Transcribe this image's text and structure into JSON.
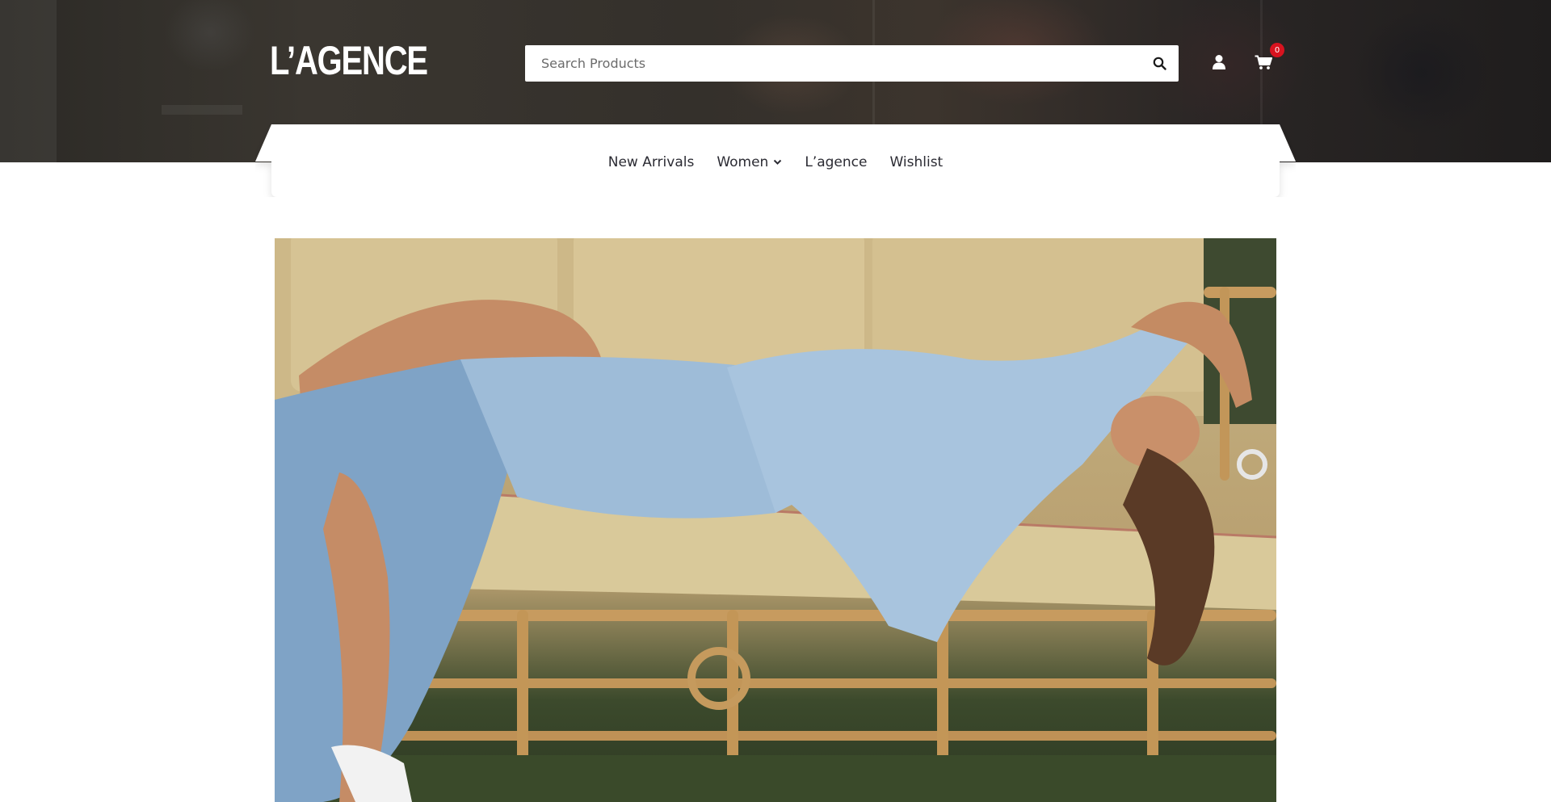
{
  "header": {
    "logo_text": "L’AGENCE",
    "search": {
      "placeholder": "Search Products",
      "value": ""
    },
    "icons": {
      "search": "search-icon",
      "account": "user-icon",
      "cart": "cart-icon"
    },
    "cart_count": "0",
    "badge_color": "#d8131f"
  },
  "nav": {
    "items": [
      {
        "label": "New Arrivals",
        "has_dropdown": false
      },
      {
        "label": "Women",
        "has_dropdown": true
      },
      {
        "label": "L’agence",
        "has_dropdown": false
      },
      {
        "label": "Wishlist",
        "has_dropdown": false
      }
    ]
  },
  "hero": {
    "image": "Model in light denim jacket and skirt reclining on a rattan sofa",
    "colors": {
      "denim": "#8fb2cf",
      "cushion": "#d9c99a",
      "rattan": "#c69a5e",
      "grass": "#3a4a2a"
    }
  }
}
